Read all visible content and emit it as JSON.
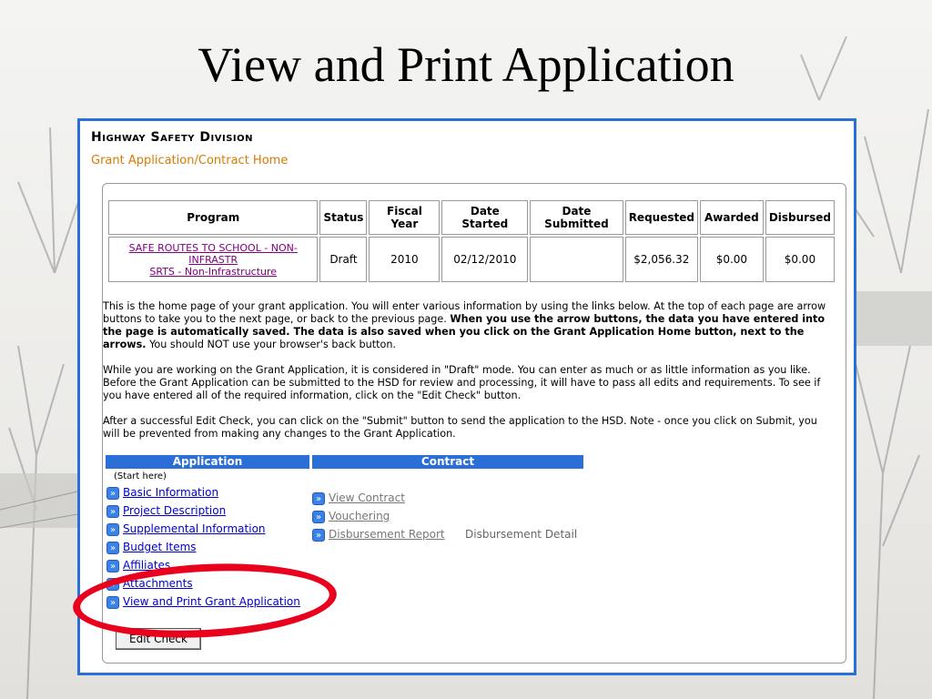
{
  "slide": {
    "title": "View and Print Application"
  },
  "header": {
    "division": "Highway Safety Division",
    "subtitle": "Grant Application/Contract Home"
  },
  "table": {
    "headers": [
      "Program",
      "Status",
      "Fiscal Year",
      "Date Started",
      "Date Submitted",
      "Requested",
      "Awarded",
      "Disbursed"
    ],
    "row": {
      "program_line1": "SAFE ROUTES TO SCHOOL - NON-INFRASTR",
      "program_line2": "SRTS - Non-Infrastructure",
      "status": "Draft",
      "fiscal_year": "2010",
      "date_started": "02/12/2010",
      "date_submitted": "",
      "requested": "$2,056.32",
      "awarded": "$0.00",
      "disbursed": "$0.00"
    }
  },
  "paragraphs": {
    "p1_a": "This is the home page of your grant application. You will enter various information by using the links below. At the top of each page are arrow buttons to take you to the next page, or back to the previous page. ",
    "p1_b": "When you use the arrow buttons, the data you have entered into the page is automatically saved. The data is also saved when you click on the Grant Application Home button, next to the arrows.",
    "p1_c": " You should NOT use your browser's back button.",
    "p2": "While you are working on the Grant Application, it is considered in \"Draft\" mode. You can enter as much or as little information as you like. Before the Grant Application can be submitted to the HSD for review and processing, it will have to pass all edits and requirements. To see if you have entered all of the required information, click on the \"Edit Check\" button.",
    "p3": "After a successful Edit Check, you can click on the \"Submit\" button to send the application to the HSD. Note - once you click on Submit, you will be prevented from making any changes to the Grant Application."
  },
  "sections": {
    "application": "Application",
    "contract": "Contract",
    "start_here": "(Start here)"
  },
  "application_links": [
    "Basic Information",
    "Project Description",
    "Supplemental Information",
    "Budget Items",
    "Affiliates",
    "Attachments",
    "View and Print Grant Application"
  ],
  "contract_links": [
    "View Contract",
    "Vouchering",
    "Disbursement Report"
  ],
  "contract_extra": "Disbursement Detail",
  "buttons": {
    "edit_check": "Edit Check"
  },
  "icons": {
    "arrow": "double-chevron-right-icon"
  },
  "colors": {
    "header_blue": "#2a6ed8",
    "subtitle_orange": "#d97a00",
    "highlight_red": "#e8001c"
  }
}
